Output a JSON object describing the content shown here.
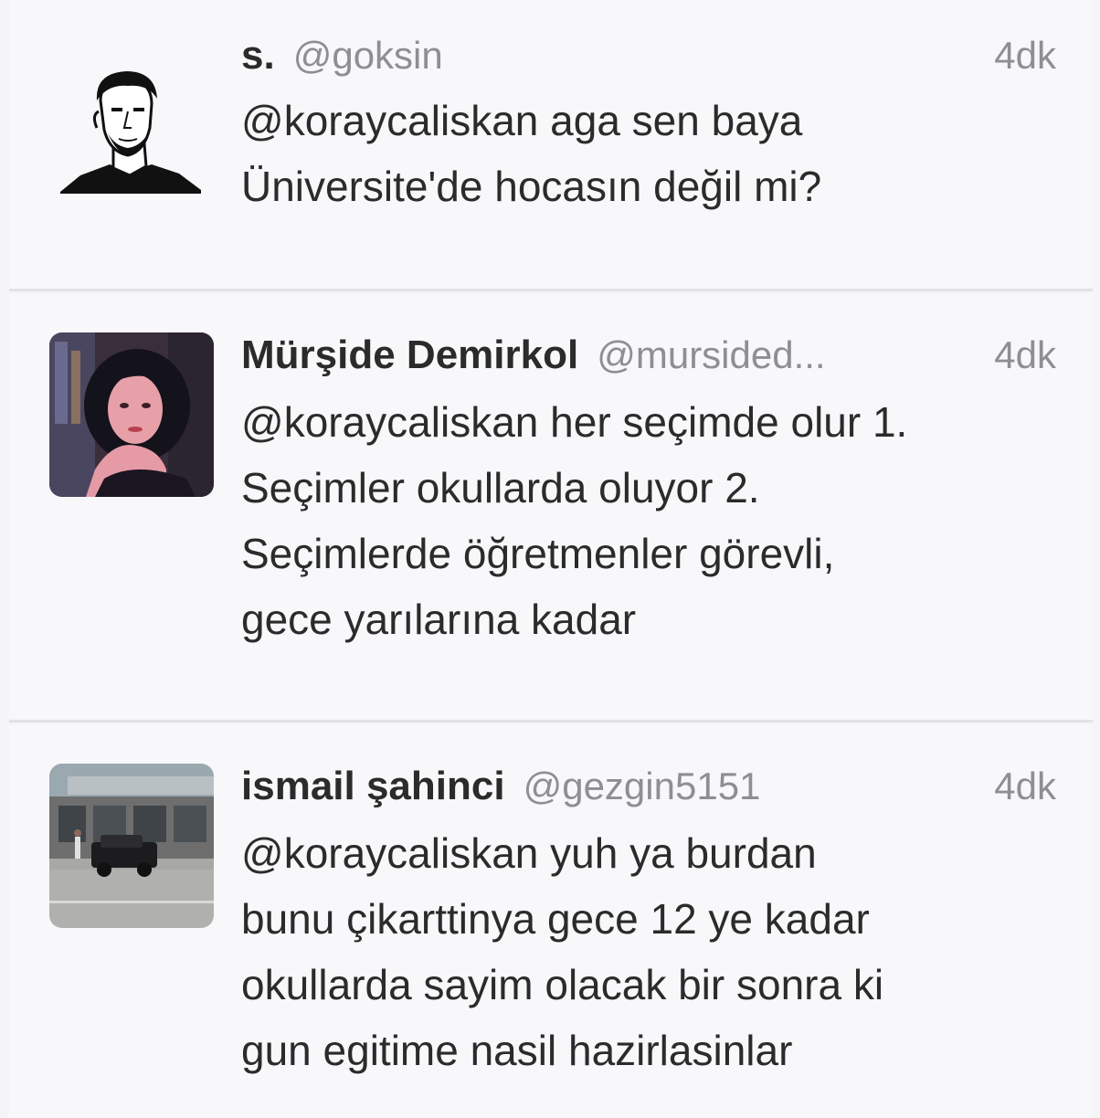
{
  "tweets": [
    {
      "name": "s.",
      "handle": "@goksin",
      "time": "4dk",
      "avatar_icon": "man-sketch-avatar",
      "lines": [
        "@koraycaliskan aga sen baya",
        "Üniversite'de hocasın değil mi?"
      ]
    },
    {
      "name": "Mürşide Demirkol",
      "handle": "@mursided...",
      "time": "4dk",
      "avatar_icon": "woman-photo-avatar",
      "lines": [
        "@koraycaliskan her seçimde olur 1.",
        "Seçimler okullarda oluyor 2.",
        "Seçimlerde öğretmenler görevli,",
        "gece yarılarına kadar"
      ]
    },
    {
      "name": "ismail şahinci",
      "handle": "@gezgin5151",
      "time": "4dk",
      "avatar_icon": "street-photo-avatar",
      "lines": [
        "@koraycaliskan yuh ya burdan",
        "bunu çikarttinya gece 12 ye kadar",
        "okullarda sayim olacak bir sonra ki",
        "gun egitime nasil hazirlasinlar"
      ]
    }
  ]
}
